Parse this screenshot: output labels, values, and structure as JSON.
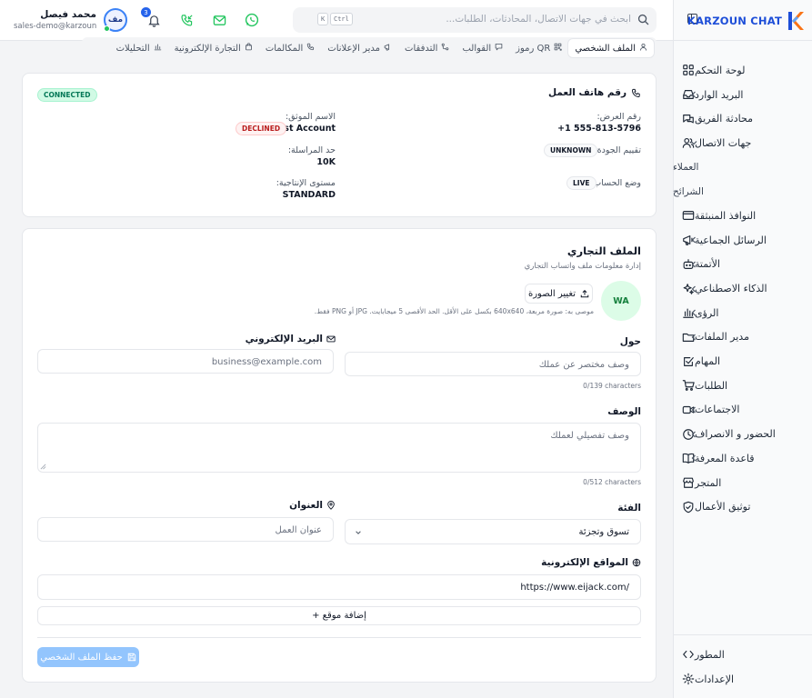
{
  "brand": {
    "name": "KARZOUN CHAT"
  },
  "header": {
    "search_placeholder": "ابحث في جهات الاتصال، المحادثات، الطلبات...",
    "kbd_k": "K",
    "kbd_ctrl": "Ctrl",
    "notification_count": "3",
    "user_initials": "مف",
    "user_name": "محمد فيصل",
    "user_email": "sales-demo@karzoun..."
  },
  "tabs": [
    "الملف الشخصي",
    "رموز QR",
    "القوالب",
    "التدفقات",
    "مدير الإعلانات",
    "المكالمات",
    "التجارة الإلكترونية",
    "التحليلات"
  ],
  "sidebar": {
    "items": [
      {
        "label": "لوحة التحكم",
        "icon": "dashboard-icon"
      },
      {
        "label": "البريد الوارد",
        "icon": "inbox-icon",
        "chevron": true
      },
      {
        "label": "محادثة الفريق",
        "icon": "team-chat-icon"
      },
      {
        "label": "جهات الاتصال",
        "icon": "contacts-icon",
        "chevron": true,
        "open": true
      },
      {
        "label": "العملاء",
        "sub": true
      },
      {
        "label": "الشرائح",
        "sub": true
      },
      {
        "label": "النوافذ المنبثقة",
        "icon": "popup-icon"
      },
      {
        "label": "الرسائل الجماعية",
        "icon": "broadcast-icon",
        "chevron": true
      },
      {
        "label": "الأتمتة",
        "icon": "bot-icon",
        "chevron": true
      },
      {
        "label": "الذكاء الاصطناعي",
        "icon": "sparkles-icon",
        "chevron": true
      },
      {
        "label": "الرؤى",
        "icon": "chart-icon",
        "chevron": true
      },
      {
        "label": "مدير الملفات",
        "icon": "folder-icon",
        "chevron": true
      },
      {
        "label": "المهام",
        "icon": "tasks-icon"
      },
      {
        "label": "الطلبات",
        "icon": "cart-icon"
      },
      {
        "label": "الاجتماعات",
        "icon": "video-icon",
        "chevron": true
      },
      {
        "label": "الحضور و الانصراف",
        "icon": "clock-icon",
        "chevron": true
      },
      {
        "label": "قاعدة المعرفة",
        "icon": "book-icon",
        "chevron": true
      },
      {
        "label": "المتجر",
        "icon": "store-icon"
      },
      {
        "label": "توثيق الأعمال",
        "icon": "shield-icon"
      }
    ],
    "bottom": [
      {
        "label": "المطور",
        "icon": "code-icon"
      },
      {
        "label": "الإعدادات",
        "icon": "settings-icon"
      }
    ]
  },
  "phone_card": {
    "title": "رقم هاتف العمل",
    "status": "CONNECTED",
    "display_number_label": "رقم العرض:",
    "display_number": "+1 555-813-5796",
    "verified_name_label": "الاسم الموثق:",
    "verified_name": "Test Account",
    "verified_status": "DECLINED",
    "quality_label": "تقييم الجودة:",
    "quality": "UNKNOWN",
    "messaging_limit_label": "حد المراسلة:",
    "messaging_limit": "10K",
    "account_mode_label": "وضع الحساب:",
    "account_mode": "LIVE",
    "throughput_label": "مستوى الإنتاجية:",
    "throughput": "STANDARD"
  },
  "business_profile": {
    "title": "الملف التجاري",
    "subtitle": "إدارة معلومات ملف واتساب التجاري",
    "avatar_initials": "WA",
    "change_photo": "تغيير الصورة",
    "photo_hint": "موصى به: صورة مربعة، 640x640 بكسل على الأقل. الحد الأقصى 5 ميجابايت. JPG أو PNG فقط.",
    "about_label": "حول",
    "about_placeholder": "وصف مختصر عن عملك",
    "about_counter": "0/139 characters",
    "email_label": "البريد الإلكتروني",
    "email_placeholder": "business@example.com",
    "description_label": "الوصف",
    "description_placeholder": "وصف تفصيلي لعملك",
    "description_counter": "0/512 characters",
    "category_label": "الفئة",
    "category_value": "تسوق وتجزئة",
    "address_label": "العنوان",
    "address_placeholder": "عنوان العمل",
    "websites_label": "المواقع الإلكترونية",
    "website_value": "https://www.eijack.com/",
    "add_website": "+ إضافة موقع",
    "save": "حفظ الملف الشخصي"
  }
}
